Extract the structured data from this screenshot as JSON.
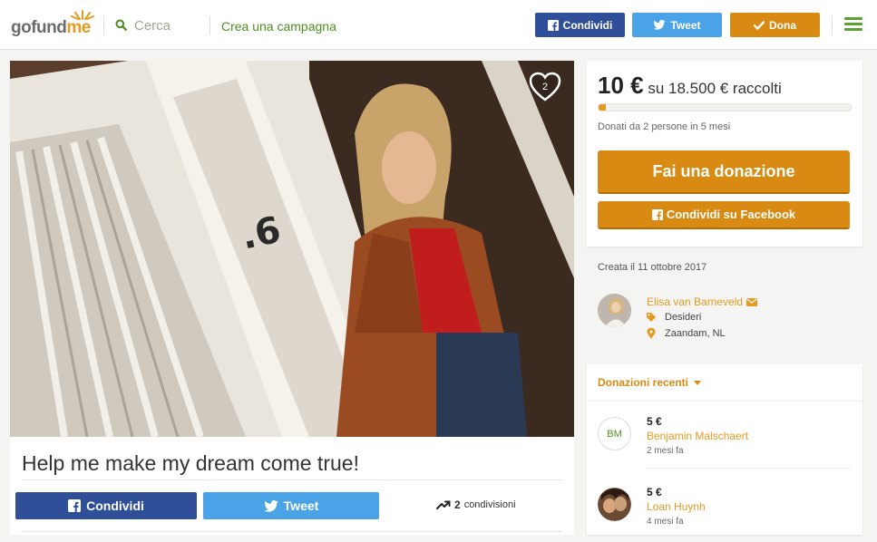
{
  "header": {
    "logo": "gofundme",
    "search_placeholder": "Cerca",
    "create_campaign": "Crea una campagna",
    "share_label": "Condividi",
    "tweet_label": "Tweet",
    "donate_label": "Dona"
  },
  "hero": {
    "house_number": ".6",
    "hearts_count": "2"
  },
  "campaign": {
    "title": "Help me make my dream come true!",
    "share_label": "Condividi",
    "tweet_label": "Tweet",
    "shares_count": "2",
    "shares_label": "condivisioni"
  },
  "funding": {
    "raised": "10 €",
    "goal_text": "su 18.500 € raccolti",
    "progress_fraction": 0.0005,
    "donors_meta": "Donati da 2 persone in 5 mesi",
    "donate_cta": "Fai una donazione",
    "share_facebook": "Condividi su Facebook"
  },
  "organizer": {
    "created": "Creata il 11 ottobre 2017",
    "name": "Elisa van Barneveld",
    "category": "Desideri",
    "location": "Zaandam, NL"
  },
  "recent": {
    "heading": "Donazioni recenti",
    "donations": [
      {
        "initials": "BM",
        "amount": "5 €",
        "name": "Benjamin Malschaert",
        "time": "2 mesi fa"
      },
      {
        "initials": "",
        "amount": "5 €",
        "name": "Loan Huynh",
        "time": "4 mesi fa"
      }
    ]
  },
  "colors": {
    "brand_orange": "#d98a13",
    "brand_green": "#4e8d22",
    "facebook_blue": "#2f4f98",
    "twitter_blue": "#4aa3e6"
  }
}
